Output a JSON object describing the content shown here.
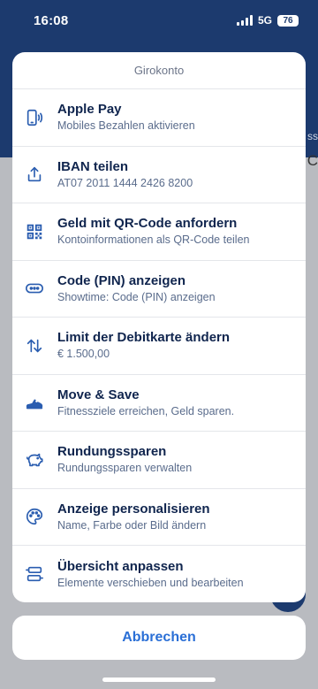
{
  "status_bar": {
    "time": "16:08",
    "network": "5G",
    "battery": "76"
  },
  "sheet": {
    "title": "Girokonto",
    "items": [
      {
        "label": "Apple Pay",
        "sub": "Mobiles Bezahlen aktivieren",
        "icon": "phone-pay-icon"
      },
      {
        "label": "IBAN teilen",
        "sub": "AT07 2011 1444 2426 8200",
        "icon": "share-icon"
      },
      {
        "label": "Geld mit QR-Code anfordern",
        "sub": "Kontoinformationen als QR-Code teilen",
        "icon": "qr-code-icon"
      },
      {
        "label": "Code (PIN) anzeigen",
        "sub": "Showtime: Code (PIN) anzeigen",
        "icon": "pin-code-icon"
      },
      {
        "label": "Limit der Debitkarte ändern",
        "sub": "€ 1.500,00",
        "icon": "up-down-arrows-icon"
      },
      {
        "label": "Move & Save",
        "sub": "Fitnessziele erreichen, Geld sparen.",
        "icon": "sneaker-icon"
      },
      {
        "label": "Rundungssparen",
        "sub": "Rundungssparen verwalten",
        "icon": "piggy-bank-icon"
      },
      {
        "label": "Anzeige personalisieren",
        "sub": "Name, Farbe oder Bild ändern",
        "icon": "palette-icon"
      },
      {
        "label": "Übersicht anpassen",
        "sub": "Elemente verschieben und bearbeiten",
        "icon": "rearrange-icon"
      }
    ]
  },
  "cancel_label": "Abbrechen",
  "colors": {
    "header_bg": "#1c3a6e",
    "label": "#10254e",
    "sub": "#5a6c8c",
    "accent": "#2a6fd6",
    "icon": "#2a5db0"
  }
}
